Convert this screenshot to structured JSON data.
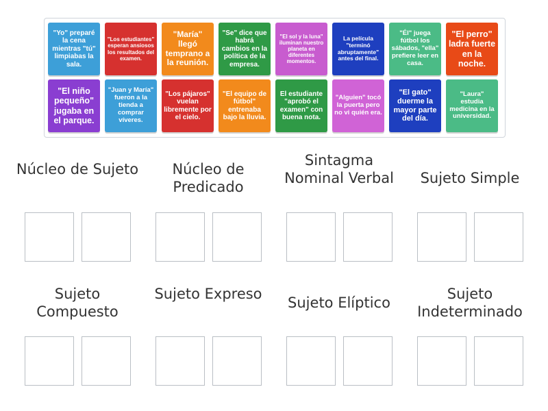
{
  "cards": [
    {
      "text": "\"Yo\" preparé la cena mientras \"tú\" limpiabas la sala.",
      "color": "#3d9fd8"
    },
    {
      "text": "\"Los estudiantes\" esperan ansiosos los resultados del examen.",
      "color": "#d6312f"
    },
    {
      "text": "\"María\" llegó temprano a la reunión.",
      "color": "#f28a1c"
    },
    {
      "text": "\"Se\" dice que habrá cambios en la política de la empresa.",
      "color": "#2f9a46"
    },
    {
      "text": "\"El sol y la luna\" iluminan nuestro planeta en diferentes momentos.",
      "color": "#c85ccf"
    },
    {
      "text": "La película \"terminó abruptamente\" antes del final.",
      "color": "#1e3fbf"
    },
    {
      "text": "\"Él\" juega fútbol los sábados, \"ella\" prefiere leer en casa.",
      "color": "#4bbb86"
    },
    {
      "text": "\"El perro\" ladra fuerte en la noche.",
      "color": "#e84a17"
    },
    {
      "text": "\"El niño pequeño\" jugaba en el parque.",
      "color": "#8a3ed1"
    },
    {
      "text": "\"Juan y María\" fueron a la tienda a comprar víveres.",
      "color": "#3d9fd8"
    },
    {
      "text": "\"Los pájaros\" vuelan libremente por el cielo.",
      "color": "#d6312f"
    },
    {
      "text": "\"El equipo de fútbol\" entrenaba bajo la lluvia.",
      "color": "#f28a1c"
    },
    {
      "text": "El estudiante \"aprobó el examen\" con buena nota.",
      "color": "#2f9a46"
    },
    {
      "text": "\"Alguien\" tocó la puerta pero no vi quién era.",
      "color": "#d063d6"
    },
    {
      "text": "\"El gato\" duerme la mayor parte del día.",
      "color": "#1e3fbf"
    },
    {
      "text": "\"Laura\" estudia medicina en la universidad.",
      "color": "#4bbb86"
    }
  ],
  "categories": [
    {
      "title": "Núcleo de Sujeto"
    },
    {
      "title": "Núcleo de Predicado"
    },
    {
      "title": "Sintagma Nominal Verbal"
    },
    {
      "title": "Sujeto Simple"
    },
    {
      "title": "Sujeto Compuesto"
    },
    {
      "title": "Sujeto Expreso"
    },
    {
      "title": "Sujeto Elíptico"
    },
    {
      "title": "Sujeto Indeterminado"
    }
  ]
}
